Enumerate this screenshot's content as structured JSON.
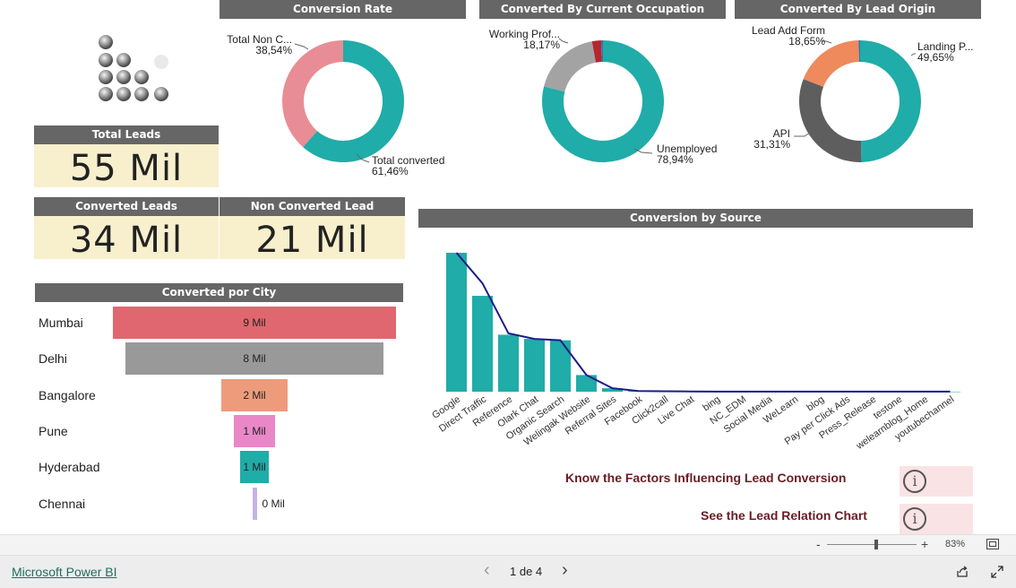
{
  "kpis": {
    "total_leads": {
      "label": "Total Leads",
      "value": "55 Mil"
    },
    "converted_leads": {
      "label": "Converted Leads",
      "value": "34 Mil"
    },
    "non_converted": {
      "label": "Non Converted Lead",
      "value": "21 Mil"
    }
  },
  "conversion_rate": {
    "title": "Conversion Rate",
    "slices": [
      {
        "name": "Total converted",
        "pct": "61,46%",
        "value": 61.46,
        "color": "#20aca8"
      },
      {
        "name": "Total Non C...",
        "pct": "38,54%",
        "value": 38.54,
        "color": "#e88d95"
      }
    ]
  },
  "occupation": {
    "title": "Converted By Current Occupation",
    "slices": [
      {
        "name": "Unemployed",
        "pct": "78,94%",
        "value": 78.94,
        "color": "#20aca8"
      },
      {
        "name": "Working Prof...",
        "pct": "18,17%",
        "value": 18.17,
        "color": "#a3a3a3"
      },
      {
        "name": "",
        "pct": "",
        "value": 2.4,
        "color": "#b5262e"
      },
      {
        "name": "",
        "pct": "",
        "value": 0.49,
        "color": "#3c6fb0"
      }
    ]
  },
  "lead_origin": {
    "title": "Converted By Lead Origin",
    "slices": [
      {
        "name": "Landing P...",
        "pct": "49,65%",
        "value": 49.65,
        "color": "#20aca8"
      },
      {
        "name": "API",
        "pct": "31,31%",
        "value": 31.31,
        "color": "#5e5e5e"
      },
      {
        "name": "Lead Add Form",
        "pct": "18,65%",
        "value": 18.65,
        "color": "#ee8a5b"
      },
      {
        "name": "",
        "pct": "",
        "value": 0.39,
        "color": "#3c6fb0"
      }
    ]
  },
  "city": {
    "title": "Converted por City",
    "rows": [
      {
        "name": "Mumbai",
        "label": "9 Mil",
        "value": 9.0,
        "color": "#e0676f"
      },
      {
        "name": "Delhi",
        "label": "8 Mil",
        "value": 8.2,
        "color": "#999999"
      },
      {
        "name": "Bangalore",
        "label": "2 Mil",
        "value": 2.1,
        "color": "#ee9b7b"
      },
      {
        "name": "Pune",
        "label": "1 Mil",
        "value": 1.3,
        "color": "#ea87c7"
      },
      {
        "name": "Hyderabad",
        "label": "1 Mil",
        "value": 0.9,
        "color": "#20aca8"
      },
      {
        "name": "Chennai",
        "label": "0 Mil",
        "value": 0.1,
        "color": "#c5b3e6"
      }
    ]
  },
  "chart_data": {
    "type": "bar",
    "title": "Conversion by Source",
    "categories": [
      "Google",
      "Direct Traffic",
      "Reference",
      "Olark Chat",
      "Organic Search",
      "Welingak Website",
      "Referral Sites",
      "Facebook",
      "Click2call",
      "Live Chat",
      "bing",
      "NC_EDM",
      "Social Media",
      "WeLearn",
      "blog",
      "Pay per Click Ads",
      "Press_Release",
      "testone",
      "welearnblog_Home",
      "youtubechannel"
    ],
    "values": [
      100,
      69,
      41,
      38,
      37,
      12,
      2.5,
      0.5,
      0.3,
      0.2,
      0.1,
      0.1,
      0.1,
      0.05,
      0.05,
      0.05,
      0.05,
      0.05,
      0.05,
      0.05
    ],
    "line_values": [
      100,
      78,
      42,
      38,
      37,
      12,
      2.5,
      0.5,
      0.3,
      0.2,
      0.1,
      0.1,
      0.1,
      0.05,
      0.05,
      0.05,
      0.05,
      0.05,
      0.05,
      0.05
    ],
    "bar_color": "#20aca8",
    "line_color": "#1b1c8a"
  },
  "links": {
    "factors": "Know the Factors Influencing Lead Conversion",
    "relation": "See the Lead Relation Chart",
    "info_glyph": "i"
  },
  "footer": {
    "zoom_minus": "-",
    "zoom_plus": "+",
    "zoom": "83%",
    "zoom_level": 0.55,
    "brand": "Microsoft Power BI",
    "page": "1 de 4",
    "prev_glyph": "‹",
    "next_glyph": "›"
  }
}
